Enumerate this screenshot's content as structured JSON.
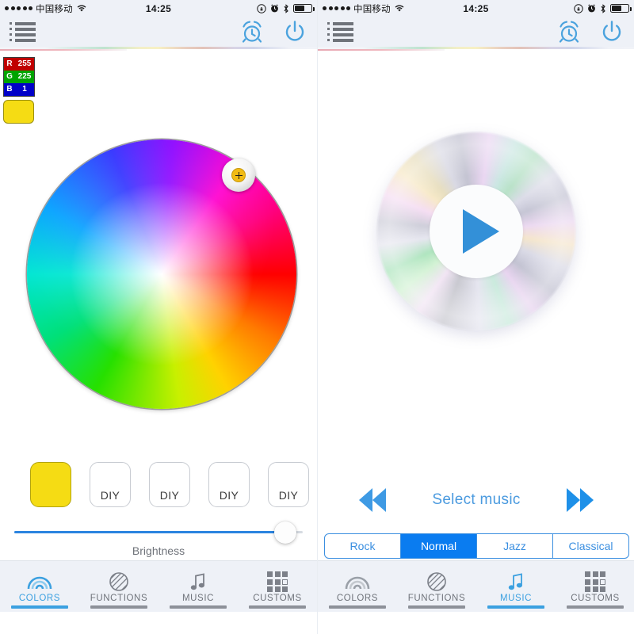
{
  "meta": {
    "app_kind": "led-controller-app",
    "panel_count": 2
  },
  "colors": {
    "accent_blue": "#3ba0e0",
    "segment_blue": "#0a7cf0",
    "slider_blue": "#2b84e0",
    "swatch_yellow": "#f5dc14",
    "statusbar_bg": "#eef1f7",
    "tab_inactive": "#6f737a"
  },
  "statusbar": {
    "carrier": "中国移动",
    "time": "14:25",
    "signal_dots": 5,
    "icons": [
      "wifi-icon",
      "rotation-lock-icon",
      "alarm-icon",
      "bluetooth-icon",
      "battery-icon"
    ],
    "battery_level_pct": 62
  },
  "navbar": {
    "menu_icon": "list-menu-icon",
    "alarm_icon": "alarm-clock-icon",
    "power_icon": "power-icon"
  },
  "colors_page": {
    "rgb_readout": {
      "rows": [
        {
          "channel": "R",
          "value": "255"
        },
        {
          "channel": "G",
          "value": "225"
        },
        {
          "channel": "B",
          "value": "1"
        }
      ]
    },
    "current_color_swatch": "#f5dc14",
    "color_wheel": {
      "name": "hsv-color-wheel",
      "selector_label": "color-picker-handle"
    },
    "presets": [
      {
        "label": "",
        "filled": true
      },
      {
        "label": "DIY",
        "filled": false
      },
      {
        "label": "DIY",
        "filled": false
      },
      {
        "label": "DIY",
        "filled": false
      },
      {
        "label": "DIY",
        "filled": false
      }
    ],
    "brightness": {
      "label": "Brightness",
      "value_pct": 94
    }
  },
  "music_page": {
    "disc_icon": "cd-disc-icon",
    "play_icon": "play-icon",
    "select_label": "Select music",
    "prev_icon": "previous-track-icon",
    "next_icon": "next-track-icon",
    "genres": [
      {
        "label": "Rock",
        "selected": false
      },
      {
        "label": "Normal",
        "selected": true
      },
      {
        "label": "Jazz",
        "selected": false
      },
      {
        "label": "Classical",
        "selected": false
      }
    ]
  },
  "tabs_left": [
    {
      "label": "COLORS",
      "icon": "rainbow-icon",
      "active": true
    },
    {
      "label": "FUNCTIONS",
      "icon": "hatched-circle-icon",
      "active": false
    },
    {
      "label": "MUSIC",
      "icon": "music-note-icon",
      "active": false
    },
    {
      "label": "CUSTOMS",
      "icon": "grid-icon",
      "active": false
    }
  ],
  "tabs_right": [
    {
      "label": "COLORS",
      "icon": "rainbow-icon",
      "active": false
    },
    {
      "label": "FUNCTIONS",
      "icon": "hatched-circle-icon",
      "active": false
    },
    {
      "label": "MUSIC",
      "icon": "music-note-icon",
      "active": true
    },
    {
      "label": "CUSTOMS",
      "icon": "grid-icon",
      "active": false
    }
  ]
}
